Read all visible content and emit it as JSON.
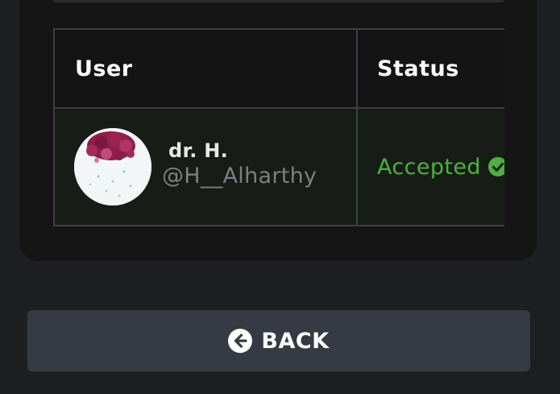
{
  "table": {
    "headers": {
      "user": "User",
      "status": "Status"
    },
    "rows": [
      {
        "display_name": "dr. H.",
        "handle": "@H__Alharthy",
        "status": "Accepted"
      }
    ]
  },
  "back_button": {
    "label": "BACK",
    "icon": "arrow-left-circle-icon"
  },
  "colors": {
    "status_accepted": "#4eb03f",
    "button_bg": "#363a42",
    "card_bg": "#151515",
    "page_bg": "#1e1f22"
  }
}
